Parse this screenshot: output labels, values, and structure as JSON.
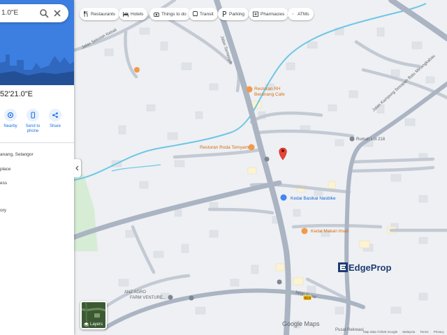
{
  "search": {
    "query": "1.0\"E"
  },
  "place": {
    "coordinates": "52'21.0\"E",
    "actions": [
      {
        "label": "Nearby",
        "icon": "nearby-icon"
      },
      {
        "label": "Send to phone",
        "icon": "phone-icon"
      },
      {
        "label": "Share",
        "icon": "share-icon"
      }
    ],
    "info_lines": [
      "anang, Selangor",
      "place",
      "ess",
      "ory"
    ]
  },
  "chips": [
    {
      "label": "Restaurants",
      "icon": "restaurant-icon"
    },
    {
      "label": "Hotels",
      "icon": "hotel-icon"
    },
    {
      "label": "Things to do",
      "icon": "camera-icon"
    },
    {
      "label": "Transit",
      "icon": "transit-icon"
    },
    {
      "label": "Parking",
      "icon": "parking-icon"
    },
    {
      "label": "Pharmacies",
      "icon": "pharmacy-icon"
    },
    {
      "label": "ATMs",
      "icon": "atm-icon"
    }
  ],
  "map": {
    "roads": [
      "Jalan Sekolah Kebali",
      "Jalan Semenyih",
      "Jalan Kampung Sesapan Batu Minangkabau",
      "Jalan Besar"
    ],
    "places": [
      {
        "name": "Restoran RH Beranang Cafe",
        "type": "restaurant"
      },
      {
        "name": "Restoran Roda Tomyam",
        "type": "restaurant"
      },
      {
        "name": "Rumah Lot 218",
        "type": "home"
      },
      {
        "name": "Kedai Basikal Nasbike",
        "type": "shop"
      },
      {
        "name": "Kedai Makan Iman",
        "type": "restaurant"
      },
      {
        "name": "ANZ AGRO FARM VENTURE...",
        "type": "business"
      },
      {
        "name": "Pusat Rekreasi",
        "type": "park"
      }
    ],
    "route_badge": "B19",
    "layers_label": "Layers",
    "google_wordmark": "Google Maps",
    "attribution": [
      "Map data ©2025 Google",
      "Malaysia",
      "Terms",
      "Privacy"
    ],
    "watermark": "EdgeProp",
    "colors": {
      "road": "#aab4c2",
      "river": "#6ec6e6",
      "pin": "#ea4335",
      "panel_header": "#3c7fe0",
      "building": "#dfe3e8"
    }
  }
}
